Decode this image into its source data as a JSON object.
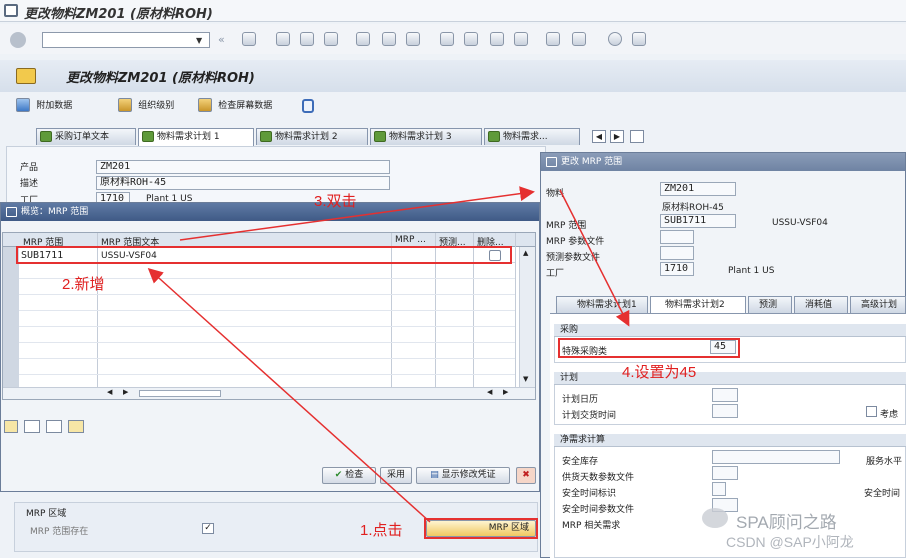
{
  "window_title": "更改物料ZM201 (原材料ROH)",
  "screen_title": "更改物料ZM201 (原材料ROH)",
  "app_toolbar": {
    "additional_data": "附加数据",
    "org_levels": "组织级别",
    "check_screen_data": "检查屏幕数据"
  },
  "main_tabs": [
    "采购订单文本",
    "物料需求计划 1",
    "物料需求计划 2",
    "物料需求计划 3",
    "物料需求..."
  ],
  "header_fields": {
    "product_label": "产品",
    "product_value": "ZM201",
    "desc_label": "描述",
    "desc_value": "原材料ROH-45",
    "plant_label": "工厂",
    "plant_value": "1710",
    "plant_name": "Plant 1 US"
  },
  "overview_dialog": {
    "title": "概览：MRP 范围",
    "columns": [
      "MRP 范围",
      "MRP 范围文本",
      "MRP ...",
      "预测...",
      "删除..."
    ],
    "rows": [
      {
        "area": "SUB1711",
        "text": "USSU-VSF04"
      }
    ],
    "buttons": {
      "check": "检查",
      "adopt": "采用",
      "show_change_docs": "显示修改凭证"
    }
  },
  "mrp_area_section": {
    "title": "MRP 区域",
    "exists_label": "MRP 范围存在",
    "button_label": "MRP 区域"
  },
  "change_dialog": {
    "title": "更改 MRP 范围",
    "material_label": "物料",
    "material_value": "ZM201",
    "material_desc": "原材料ROH-45",
    "mrp_area_label": "MRP 范围",
    "mrp_area_value": "SUB1711",
    "mrp_area_text": "USSU-VSF04",
    "mrp_profile_label": "MRP 参数文件",
    "forecast_profile_label": "预测参数文件",
    "plant_label": "工厂",
    "plant_value": "1710",
    "plant_name": "Plant 1 US",
    "tabs": [
      "物料需求计划1",
      "物料需求计划2",
      "预测",
      "消耗值",
      "高级计划"
    ],
    "procurement_title": "采购",
    "special_proc_label": "特殊采购类",
    "special_proc_value": "45",
    "planning_title": "计划",
    "planning_calendar_label": "计划日历",
    "planning_time_fence_label": "计划交货时间",
    "consider_label": "考虑",
    "net_req_title": "净需求计算",
    "safety_stock_label": "安全库存",
    "service_level_label": "服务水平",
    "coverage_profile_label": "供货天数参数文件",
    "safety_time_ind_label": "安全时间标识",
    "safety_time_label": "安全时间",
    "safety_time_profile_label": "安全时间参数文件",
    "mrp_dep_req_label": "MRP 相关需求"
  },
  "annotations": {
    "step1": "1.点击",
    "step2": "2.新增",
    "step3": "3.双击",
    "step4": "4.设置为45"
  },
  "watermark": {
    "line1": "SPA顾问之路",
    "line2": "CSDN @SAP小阿龙"
  },
  "colors": {
    "annotation_red": "#e53030",
    "title_blue": "#3f5a86"
  }
}
